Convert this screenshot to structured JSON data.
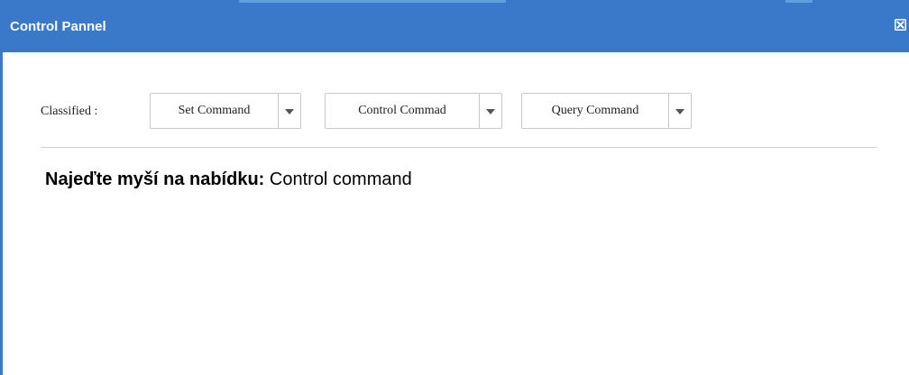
{
  "window": {
    "title": "Control Pannel",
    "accent_color": "#3a78c9",
    "close_icon": "close-icon"
  },
  "toolbar": {
    "classified_label": "Classified :",
    "buttons": [
      {
        "label": "Set Command",
        "icon": "chevron-down-icon"
      },
      {
        "label": "Control Commad",
        "icon": "chevron-down-icon"
      },
      {
        "label": "Query Command",
        "icon": "chevron-down-icon"
      }
    ]
  },
  "hint": {
    "label": "Najeďte myší na nabídku:",
    "value": "Control command"
  }
}
